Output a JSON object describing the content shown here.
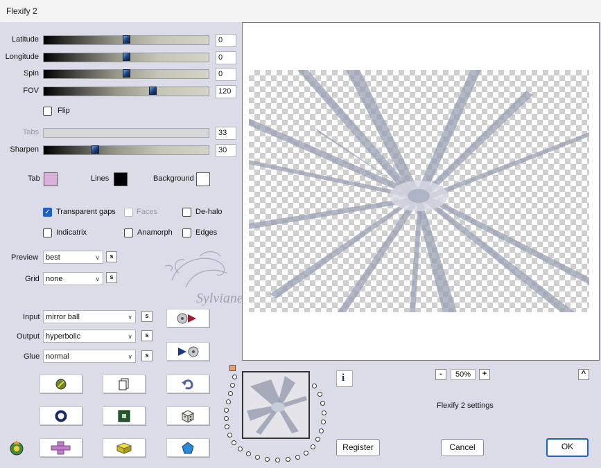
{
  "window": {
    "title": "Flexify 2"
  },
  "sliders": [
    {
      "label": "Latitude",
      "value": "0",
      "level": 0.5,
      "disabled": false
    },
    {
      "label": "Longitude",
      "value": "0",
      "level": 0.5,
      "disabled": false
    },
    {
      "label": "Spin",
      "value": "0",
      "level": 0.5,
      "disabled": false
    },
    {
      "label": "FOV",
      "value": "120",
      "level": 0.67,
      "disabled": false
    },
    {
      "label": "Tabs",
      "value": "33",
      "level": 0.0,
      "disabled": true
    },
    {
      "label": "Sharpen",
      "value": "30",
      "level": 0.3,
      "disabled": false
    }
  ],
  "flip": {
    "label": "Flip",
    "checked": false
  },
  "colors": {
    "tab": {
      "label": "Tab",
      "color": "#dcb0dc"
    },
    "lines": {
      "label": "Lines",
      "color": "#000000"
    },
    "background": {
      "label": "Background",
      "color": "#ffffff"
    }
  },
  "options": {
    "transparent_gaps": {
      "label": "Transparent gaps",
      "checked": true
    },
    "faces": {
      "label": "Faces",
      "checked": false,
      "disabled": true
    },
    "dehalo": {
      "label": "De-halo",
      "checked": false
    },
    "indicatrix": {
      "label": "Indicatrix",
      "checked": false
    },
    "anamorph": {
      "label": "Anamorph",
      "checked": false
    },
    "edges": {
      "label": "Edges",
      "checked": false
    }
  },
  "preview_select": {
    "label": "Preview",
    "value": "best"
  },
  "grid_select": {
    "label": "Grid",
    "value": "none"
  },
  "input_select": {
    "label": "Input",
    "value": "mirror ball"
  },
  "output_select": {
    "label": "Output",
    "value": "hyperbolic"
  },
  "glue_select": {
    "label": "Glue",
    "value": "normal"
  },
  "s_label": "s",
  "zoom": {
    "value": "50%",
    "minus": "-",
    "plus": "+"
  },
  "settings_label": "Flexify 2 settings",
  "expand_label": "^",
  "info_label": "i",
  "buttons": {
    "register": "Register",
    "cancel": "Cancel",
    "ok": "OK"
  },
  "watermark": "Sylviane",
  "accent_color": "#1f5fbf"
}
